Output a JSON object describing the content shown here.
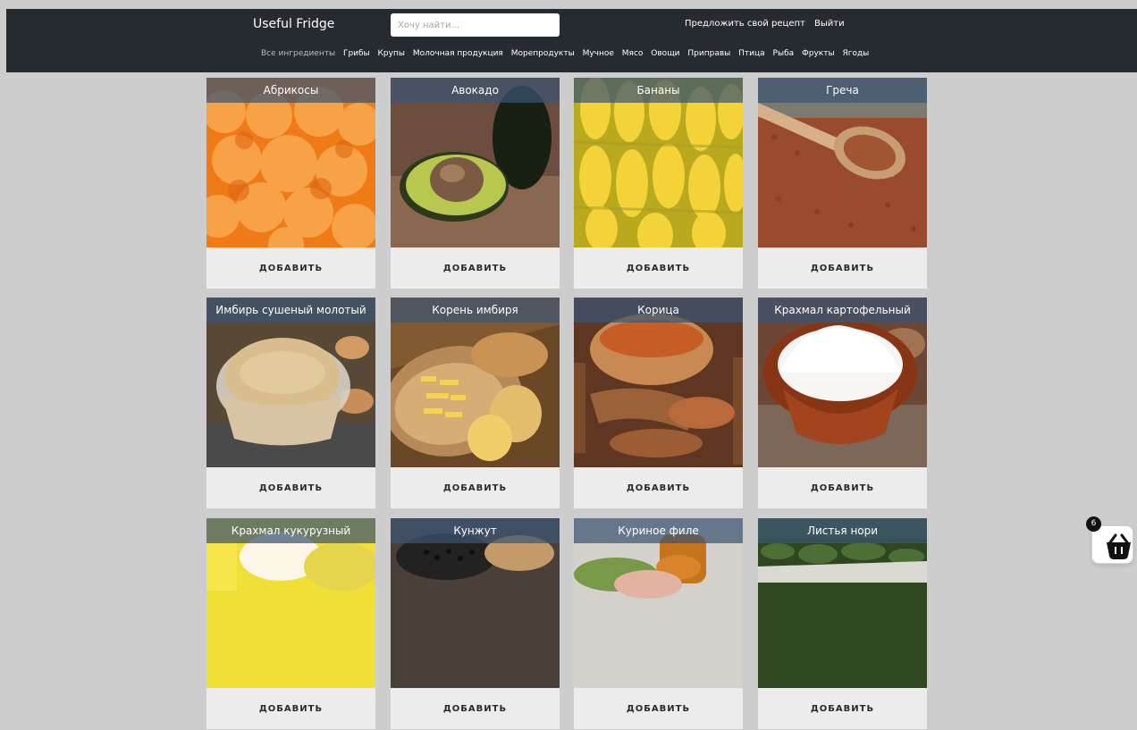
{
  "header": {
    "brand": "Useful Fridge",
    "search_placeholder": "Хочу найти...",
    "links": [
      "Предложить свой рецепт",
      "Выйти"
    ]
  },
  "categories": [
    "Все ингредиенты",
    "Грибы",
    "Крупы",
    "Молочная продукция",
    "Морепродукты",
    "Мучное",
    "Мясо",
    "Овощи",
    "Приправы",
    "Птица",
    "Рыба",
    "Фрукты",
    "Ягоды"
  ],
  "products": [
    {
      "name": "Абрикосы",
      "button": "ДОБАВИТЬ"
    },
    {
      "name": "Авокадо",
      "button": "ДОБАВИТЬ"
    },
    {
      "name": "Бананы",
      "button": "ДОБАВИТЬ"
    },
    {
      "name": "Греча",
      "button": "ДОБАВИТЬ"
    },
    {
      "name": "Имбирь сушеный молотый",
      "button": "ДОБАВИТЬ"
    },
    {
      "name": "Корень имбиря",
      "button": "ДОБАВИТЬ"
    },
    {
      "name": "Корица",
      "button": "ДОБАВИТЬ"
    },
    {
      "name": "Крахмал картофельный",
      "button": "ДОБАВИТЬ"
    },
    {
      "name": "Крахмал кукурузный",
      "button": "ДОБАВИТЬ"
    },
    {
      "name": "Кунжут",
      "button": "ДОБАВИТЬ"
    },
    {
      "name": "Куриное филе",
      "button": "ДОБАВИТЬ"
    },
    {
      "name": "Листья нори",
      "button": "ДОБАВИТЬ"
    }
  ],
  "cart": {
    "count": "6",
    "icon": "basket-icon"
  },
  "colors": {
    "header_bg": "#262b30",
    "page_bg": "#cdcdcd",
    "title_overlay": "#3b5473",
    "card_bg": "#ececec"
  }
}
